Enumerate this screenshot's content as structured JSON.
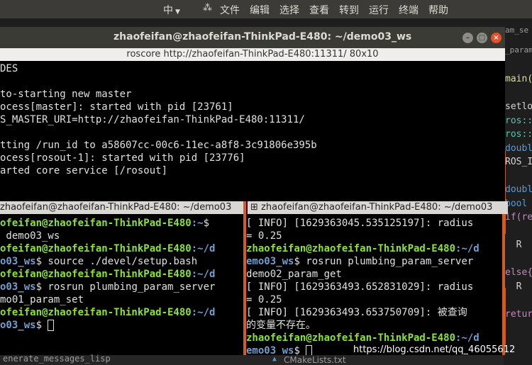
{
  "topbar": {
    "ime": "中",
    "menu": [
      "文件",
      "编辑",
      "选择",
      "查看",
      "转到",
      "运行",
      "终端",
      "帮助"
    ]
  },
  "editor": {
    "tab1": "am_se",
    "tab2": "_param",
    "lines": [
      "main(",
      "",
      "setlo",
      "ros::",
      "ros::",
      "doubl",
      "ROS_I",
      "",
      "doubl",
      "bool",
      "if(re",
      "",
      "  R",
      "",
      "else{",
      "  R",
      "",
      "retur"
    ]
  },
  "window": {
    "title": "zhaofeifan@zhaofeifan-ThinkPad-E480: ~/demo03_ws",
    "subtitle": "roscore http://zhaofeifan-ThinkPad-E480:11311/ 80x10"
  },
  "top_pane": {
    "lines": [
      "DES",
      "",
      "to-starting new master",
      "ocess[master]: started with pid [23761]",
      "S_MASTER_URI=http://zhaofeifan-ThinkPad-E480:11311/",
      "",
      "tting /run_id to a58607cc-00c6-11ec-a8f8-3c91806e395b",
      "ocess[rosout-1]: started with pid [23776]",
      "arted core service [/rosout]"
    ]
  },
  "left_pane": {
    "header": "zhaofeifan@zhaofeifan-ThinkPad-E480: ~/demo03",
    "lines": [
      {
        "user": "ofeifan@zhaofeifan-ThinkPad-E480",
        "path": ":~",
        "rest": "$"
      },
      {
        "plain": " demo03_ws"
      },
      {
        "user": "ofeifan@zhaofeifan-ThinkPad-E480",
        "path": ":~/d",
        "rest": ""
      },
      {
        "path": "o03_ws",
        "rest": "$ source ./devel/setup.bash"
      },
      {
        "user": "ofeifan@zhaofeifan-ThinkPad-E480",
        "path": ":~/d",
        "rest": ""
      },
      {
        "path": "o03_ws",
        "rest": "$ rosrun plumbing_param_server"
      },
      {
        "plain": "mo01_param_set"
      },
      {
        "user": "ofeifan@zhaofeifan-ThinkPad-E480",
        "path": ":~/d",
        "rest": ""
      },
      {
        "path": "o03_ws",
        "rest": "$ "
      }
    ]
  },
  "right_pane": {
    "header": "zhaofeifan@zhaofeifan-ThinkPad-E480: ~/demo03",
    "lines": [
      {
        "plain": "[ INFO] [1629363045.535125197]: radius"
      },
      {
        "plain": "= 0.25"
      },
      {
        "user": "zhaofeifan@zhaofeifan-ThinkPad-E480",
        "path": ":~/d",
        "rest": ""
      },
      {
        "path": "emo03_ws",
        "rest": "$ rosrun plumbing_param_server"
      },
      {
        "plain": "demo02_param_get"
      },
      {
        "plain": "[ INFO] [1629363493.652831029]: radius"
      },
      {
        "plain": "= 0.25"
      },
      {
        "plain": "[ INFO] [1629363493.653750709]: 被查询"
      },
      {
        "plain": "的变量不存在。"
      },
      {
        "user": "zhaofeifan@zhaofeifan-ThinkPad-E480",
        "path": ":~/d",
        "rest": ""
      },
      {
        "path": "emo03_ws",
        "rest": "$ "
      }
    ]
  },
  "bottom": {
    "left_text": "enerate_messages_lisp",
    "file": "CMakeLists.txt"
  },
  "watermark": "https://blog.csdn.net/qq_46055612"
}
